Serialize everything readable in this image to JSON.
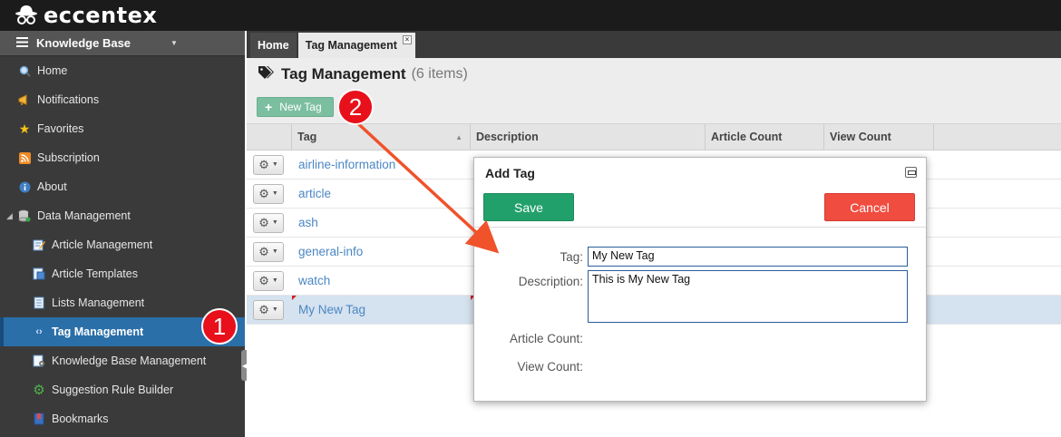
{
  "brand": {
    "name": "eccentex"
  },
  "sidebar": {
    "header": "Knowledge Base",
    "items": [
      {
        "label": "Home",
        "icon": "magnifier-icon"
      },
      {
        "label": "Notifications",
        "icon": "megaphone-icon"
      },
      {
        "label": "Favorites",
        "icon": "star-icon"
      },
      {
        "label": "Subscription",
        "icon": "rss-icon"
      },
      {
        "label": "About",
        "icon": "info-icon"
      },
      {
        "label": "Data Management",
        "icon": "database-icon"
      },
      {
        "label": "Article Management",
        "icon": "edit-document-icon"
      },
      {
        "label": "Article Templates",
        "icon": "template-icon"
      },
      {
        "label": "Lists Management",
        "icon": "list-document-icon"
      },
      {
        "label": "Tag Management",
        "icon": "code-tag-icon"
      },
      {
        "label": "Knowledge Base Management",
        "icon": "kb-settings-icon"
      },
      {
        "label": "Suggestion Rule Builder",
        "icon": "gear-green-icon"
      },
      {
        "label": "Bookmarks",
        "icon": "bookmark-icon"
      }
    ]
  },
  "tabs": [
    {
      "label": "Home"
    },
    {
      "label": "Tag Management"
    }
  ],
  "page": {
    "title": "Tag Management",
    "count": "(6 items)"
  },
  "toolbar": {
    "new_tag_label": "New Tag"
  },
  "grid": {
    "columns": [
      "Tag",
      "Description",
      "Article Count",
      "View Count"
    ],
    "rows": [
      {
        "tag": "airline-information"
      },
      {
        "tag": "article"
      },
      {
        "tag": "ash"
      },
      {
        "tag": "general-info"
      },
      {
        "tag": "watch"
      },
      {
        "tag": "My New Tag"
      }
    ]
  },
  "dialog": {
    "title": "Add Tag",
    "save_label": "Save",
    "cancel_label": "Cancel",
    "fields": {
      "tag_label": "Tag:",
      "tag_value": "My New Tag",
      "description_label": "Description:",
      "description_value": "This is My New Tag",
      "article_count_label": "Article Count:",
      "view_count_label": "View Count:"
    }
  },
  "annotations": {
    "badge1": "1",
    "badge2": "2",
    "accent": "#e8101a",
    "arrow_color": "#f0522a"
  }
}
